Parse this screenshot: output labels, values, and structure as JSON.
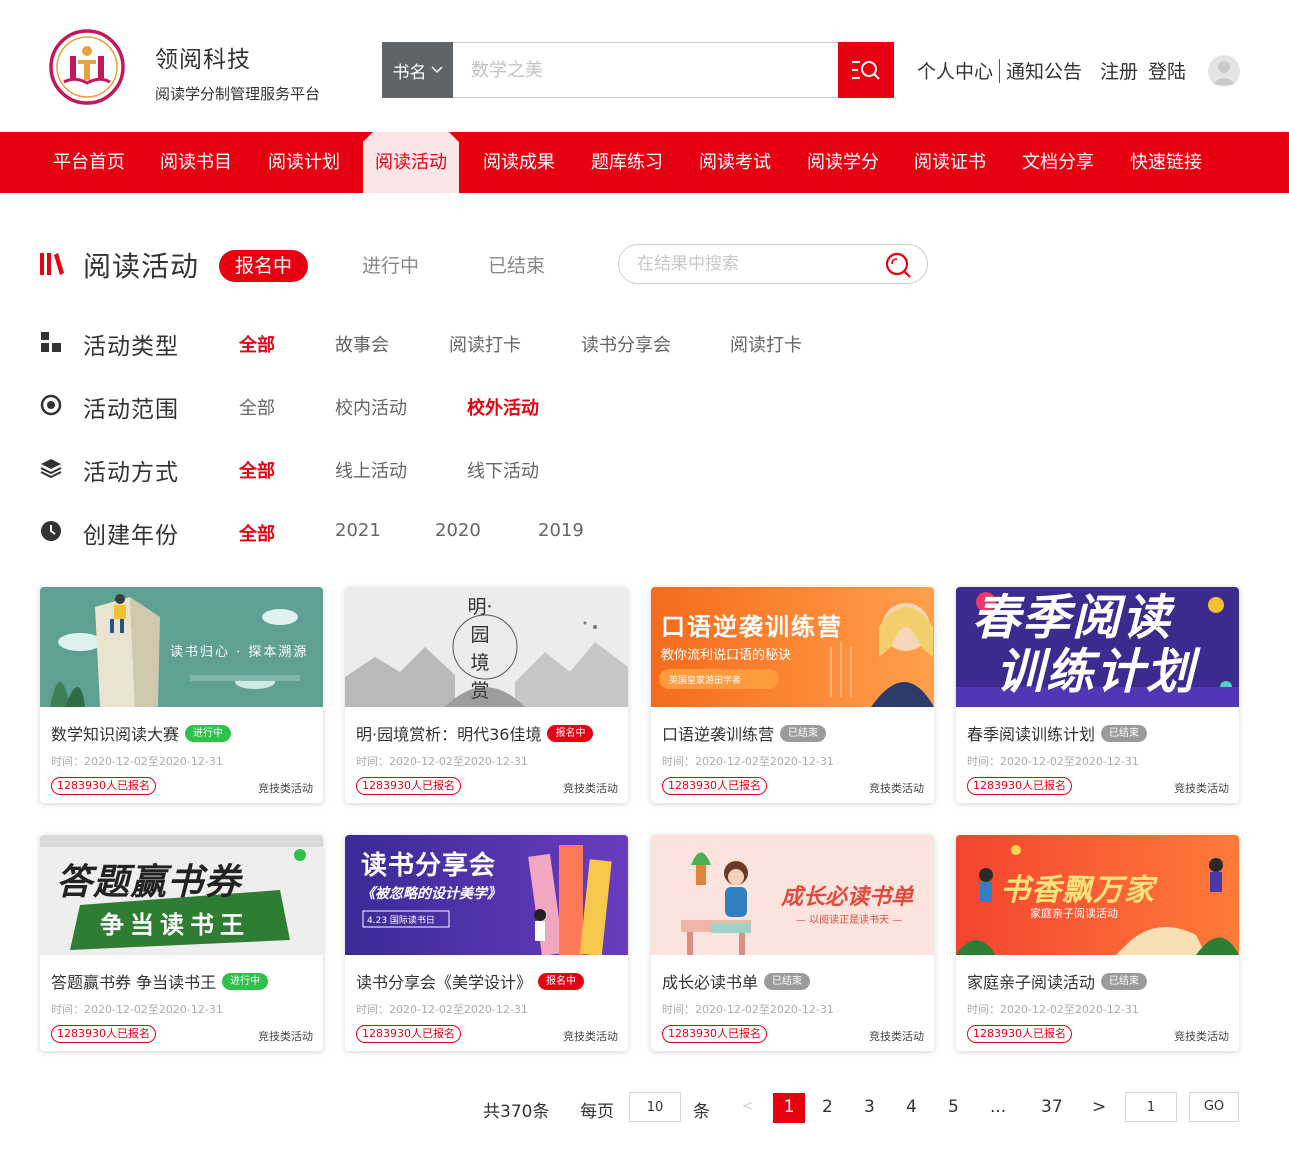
{
  "header": {
    "brand_name": "领阅科技",
    "brand_sub": "阅读学分制管理服务平台",
    "search_type": "书名",
    "search_placeholder": "数学之美",
    "links": [
      "个人中心",
      "通知公告",
      "注册",
      "登陆"
    ]
  },
  "nav": {
    "items": [
      "平台首页",
      "阅读书目",
      "阅读计划",
      "阅读活动",
      "阅读成果",
      "题库练习",
      "阅读考试",
      "阅读学分",
      "阅读证书",
      "文档分享",
      "快速链接"
    ],
    "active": "阅读活动"
  },
  "section": {
    "title": "阅读活动",
    "tabs": [
      "报名中",
      "进行中",
      "已结束"
    ],
    "active_tab": "报名中",
    "search_placeholder": "在结果中搜索"
  },
  "filters": [
    {
      "title": "活动类型",
      "icon": "grid-icon",
      "options": [
        "全部",
        "故事会",
        "阅读打卡",
        "读书分享会",
        "阅读打卡"
      ],
      "active": 0
    },
    {
      "title": "活动范围",
      "icon": "target-icon",
      "options": [
        "全部",
        "校内活动",
        "校外活动"
      ],
      "active": 2
    },
    {
      "title": "活动方式",
      "icon": "layers-icon",
      "options": [
        "全部",
        "线上活动",
        "线下活动"
      ],
      "active": 0
    },
    {
      "title": "创建年份",
      "icon": "clock-icon",
      "options": [
        "全部",
        "2021",
        "2020",
        "2019"
      ],
      "active": 0
    }
  ],
  "cards": [
    {
      "title": "数学知识阅读大赛",
      "status": "进行中",
      "time": "时间：2020-12-02至2020-12-31",
      "count": "1283930人已报名",
      "type": "竞技类活动",
      "banner": "读书归心 · 探本溯源"
    },
    {
      "title": "明·园境赏析：明代36佳境",
      "status": "报名中",
      "time": "时间：2020-12-02至2020-12-31",
      "count": "1283930人已报名",
      "type": "竞技类活动",
      "banner": "明·园境 赏析"
    },
    {
      "title": "口语逆袭训练营",
      "status": "已结束",
      "time": "时间：2020-12-02至2020-12-31",
      "count": "1283930人已报名",
      "type": "竞技类活动",
      "banner": "口语逆袭训练营",
      "banner_sub": "教你流利说口语的秘诀",
      "banner_tag": "英国皇家游田学者"
    },
    {
      "title": "春季阅读训练计划",
      "status": "已结束",
      "time": "时间：2020-12-02至2020-12-31",
      "count": "1283930人已报名",
      "type": "竞技类活动",
      "banner": "春季阅读",
      "banner_sub": "训练计划"
    },
    {
      "title": "答题赢书券 争当读书王",
      "status": "进行中",
      "time": "时间：2020-12-02至2020-12-31",
      "count": "1283930人已报名",
      "type": "竞技类活动",
      "banner": "答题赢书券",
      "banner_sub": "争当读书王"
    },
    {
      "title": "读书分享会《美学设计》",
      "status": "报名中",
      "time": "时间：2020-12-02至2020-12-31",
      "count": "1283930人已报名",
      "type": "竞技类活动",
      "banner": "读书分享会",
      "banner_sub": "《被忽略的设计美学》",
      "banner_tag": "4.23 国际读书日"
    },
    {
      "title": "成长必读书单",
      "status": "已结束",
      "time": "时间：2020-12-02至2020-12-31",
      "count": "1283930人已报名",
      "type": "竞技类活动",
      "banner": "成长必读书单",
      "banner_sub": "— 以阅读正是读书天 —"
    },
    {
      "title": "家庭亲子阅读活动",
      "status": "已结束",
      "time": "时间：2020-12-02至2020-12-31",
      "count": "1283930人已报名",
      "type": "竞技类活动",
      "banner": "书香飘万家",
      "banner_sub": "家庭亲子阅读活动"
    }
  ],
  "status_colors": {
    "进行中": "#2fc24a",
    "报名中": "#e60012",
    "已结束": "#9b9b9b"
  },
  "pagination": {
    "total": "共370条",
    "per_page_label": "每页",
    "per_page": "10",
    "unit": "条",
    "prev": "<",
    "pages": [
      "1",
      "2",
      "3",
      "4",
      "5",
      "...",
      "37"
    ],
    "current": "1",
    "next": ">",
    "goto_value": "1",
    "go_label": "GO"
  },
  "colors": {
    "brand_red": "#e60012",
    "nav_active_bg": "#fce5e6",
    "search_type_bg": "#5f6469"
  }
}
